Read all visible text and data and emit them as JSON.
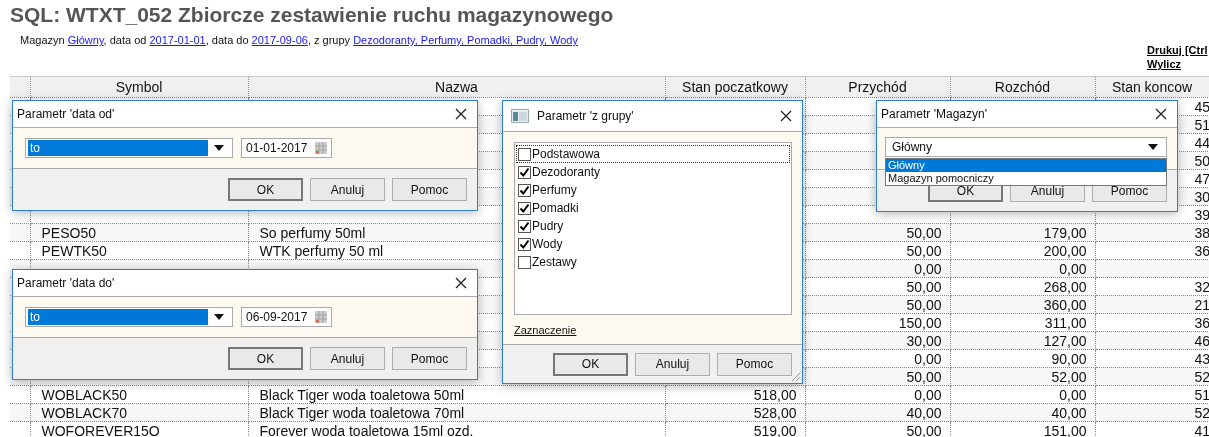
{
  "report": {
    "title": "SQL: WTXT_052 Zbiorcze zestawienie ruchu magazynowego",
    "summary": [
      {
        "text": "Magazyn ",
        "kind": "plain"
      },
      {
        "text": "Główny",
        "kind": "link"
      },
      {
        "text": ", data od ",
        "kind": "plain"
      },
      {
        "text": "2017-01-01",
        "kind": "link"
      },
      {
        "text": ", data do ",
        "kind": "plain"
      },
      {
        "text": "2017-09-06",
        "kind": "link"
      },
      {
        "text": ", z grupy ",
        "kind": "plain"
      },
      {
        "text": "Dezodoranty, Perfumy, Pomadki, Pudry, Wody",
        "kind": "link"
      }
    ]
  },
  "actions": [
    "Drukuj [Ctrl",
    "Wylicz"
  ],
  "table": {
    "columns": [
      "Symbol",
      "Nazwa",
      "Stan poczatkowy",
      "Przychód",
      "Rozchód",
      "Stan koncow"
    ],
    "rows": [
      {
        "cells": [
          null,
          null,
          null,
          null,
          null,
          "45"
        ]
      },
      {
        "cells": [
          null,
          null,
          null,
          null,
          null,
          "51"
        ]
      },
      {
        "cells": [
          null,
          null,
          null,
          null,
          null,
          "44"
        ]
      },
      {
        "cells": [
          null,
          null,
          null,
          null,
          null,
          "50"
        ]
      },
      {
        "cells": [
          null,
          null,
          null,
          null,
          null,
          "47"
        ]
      },
      {
        "cells": [
          null,
          null,
          null,
          null,
          null,
          "30"
        ]
      },
      {
        "cells": [
          null,
          null,
          null,
          null,
          null,
          "39"
        ]
      },
      {
        "cells": [
          "PESO50",
          "So perfumy 50ml",
          null,
          "50,00",
          "179,00",
          "38"
        ]
      },
      {
        "cells": [
          "PEWTK50",
          "WTK perfumy 50 ml",
          null,
          "50,00",
          "200,00",
          "36"
        ]
      },
      {
        "cells": [
          null,
          null,
          null,
          "0,00",
          "0,00",
          null
        ]
      },
      {
        "cells": [
          null,
          null,
          null,
          "50,00",
          "268,00",
          "32"
        ]
      },
      {
        "cells": [
          null,
          null,
          null,
          "50,00",
          "360,00",
          "21"
        ]
      },
      {
        "cells": [
          null,
          null,
          null,
          "150,00",
          "311,00",
          "36"
        ]
      },
      {
        "cells": [
          null,
          null,
          null,
          "30,00",
          "127,00",
          "46"
        ]
      },
      {
        "cells": [
          null,
          null,
          null,
          "0,00",
          "90,00",
          "43"
        ]
      },
      {
        "cells": [
          null,
          null,
          null,
          "50,00",
          "52,00",
          "52"
        ]
      },
      {
        "cells": [
          "WOBLACK50",
          "Black Tiger woda toaletowa 50ml",
          "518,00",
          "0,00",
          "0,00",
          "51"
        ]
      },
      {
        "cells": [
          "WOBLACK70",
          "Black Tiger woda toaletowa 70ml",
          "528,00",
          "40,00",
          "40,00",
          "52"
        ]
      },
      {
        "cells": [
          "WOFOREVER15O",
          "Forever woda toaletowa 15ml ozd.",
          "519,00",
          "50,00",
          "151,00",
          "41"
        ]
      }
    ]
  },
  "dialogs": [
    {
      "kind": "date",
      "title": "Parametr 'data od'",
      "operator": "to",
      "date": "01-01-2017",
      "buttons": [
        {
          "label": "OK",
          "default": true
        },
        {
          "label": "Anuluj",
          "default": false
        },
        {
          "label": "Pomoc",
          "default": false
        }
      ]
    },
    {
      "kind": "checklist",
      "title": "Parametr 'z grupy'",
      "items": [
        {
          "label": "Podstawowa",
          "checked": false
        },
        {
          "label": "Dezodoranty",
          "checked": true
        },
        {
          "label": "Perfumy",
          "checked": true
        },
        {
          "label": "Pomadki",
          "checked": true
        },
        {
          "label": "Pudry",
          "checked": true
        },
        {
          "label": "Wody",
          "checked": true
        },
        {
          "label": "Zestawy",
          "checked": false
        }
      ],
      "link": "Zaznaczenie",
      "buttons": [
        {
          "label": "OK",
          "default": true
        },
        {
          "label": "Anuluj",
          "default": false
        },
        {
          "label": "Pomoc",
          "default": false
        }
      ]
    },
    {
      "kind": "dropdown",
      "title": "Parametr 'Magazyn'",
      "value": "Główny",
      "options": [
        {
          "label": "Główny",
          "selected": true
        },
        {
          "label": "Magazyn pomocniczy",
          "selected": false
        }
      ],
      "buttons": [
        {
          "label": "OK",
          "default": true
        },
        {
          "label": "Anuluj",
          "default": false
        },
        {
          "label": "Pomoc",
          "default": false
        }
      ]
    },
    {
      "kind": "date",
      "title": "Parametr 'data do'",
      "operator": "to",
      "date": "06-09-2017",
      "buttons": [
        {
          "label": "OK",
          "default": true
        },
        {
          "label": "Anuluj",
          "default": false
        },
        {
          "label": "Pomoc",
          "default": false
        }
      ]
    }
  ]
}
